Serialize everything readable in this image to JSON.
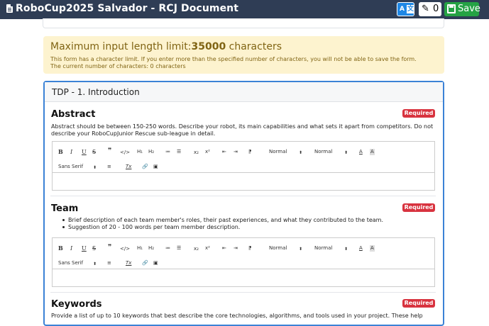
{
  "header": {
    "title": "RoboCup2025 Salvador - RCJ Document",
    "translate_left": "A",
    "translate_right": "文",
    "edit_count": "0",
    "edit_glyph": "✎",
    "save_label": "Save"
  },
  "warning": {
    "title_prefix": "Maximum input length limit:",
    "title_number": "35000",
    "title_suffix": " characters",
    "line1": "This form has a character limit. If you enter more than the specified number of characters, you will not be able to save the form.",
    "line2": "The current number of characters: 0 characters"
  },
  "section": {
    "title": "TDP - 1. Introduction"
  },
  "questions": [
    {
      "title": "Abstract",
      "required": "Required",
      "description": "Abstract should be between 150-250 words. Describe your robot, its main capabilities and what sets it apart from competitors. Do not describe your RoboCupJunior Rescue sub-league in detail."
    },
    {
      "title": "Team",
      "required": "Required",
      "bullets": [
        "Brief description of each team member's roles, their past experiences, and what they contributed to the team.",
        "Suggestion of 20 - 100 words per team member description."
      ]
    },
    {
      "title": "Keywords",
      "required": "Required",
      "description": "Provide a list of up to 10 keywords that best describe the core technologies, algorithms, and tools used in your project. These help"
    }
  ],
  "toolbar": {
    "bold": "B",
    "italic": "I",
    "underline": "U",
    "strike": "S",
    "blockquote": "❞",
    "code": "</>",
    "h1": "H₁",
    "h2": "H₂",
    "ordered_list": "≔",
    "bullet_list": "☰",
    "subscript": "x₂",
    "superscript": "x²",
    "outdent": "⇤",
    "indent": "⇥",
    "direction": "⁋",
    "size_select": "Normal",
    "header_select": "Normal",
    "font_color": "A",
    "background_color": "A",
    "font_select": "Sans Serif",
    "align": "≡",
    "clean": "Tx",
    "link": "🔗",
    "image": "▣",
    "select_arrow": "⬍"
  },
  "colors": {
    "header_bg": "#2f3d55",
    "translate_button": "#1f87e5",
    "save_button": "#25a244",
    "warning_bg": "#fdf3cf",
    "section_border": "#3b82d6",
    "required_badge": "#d8333f"
  }
}
